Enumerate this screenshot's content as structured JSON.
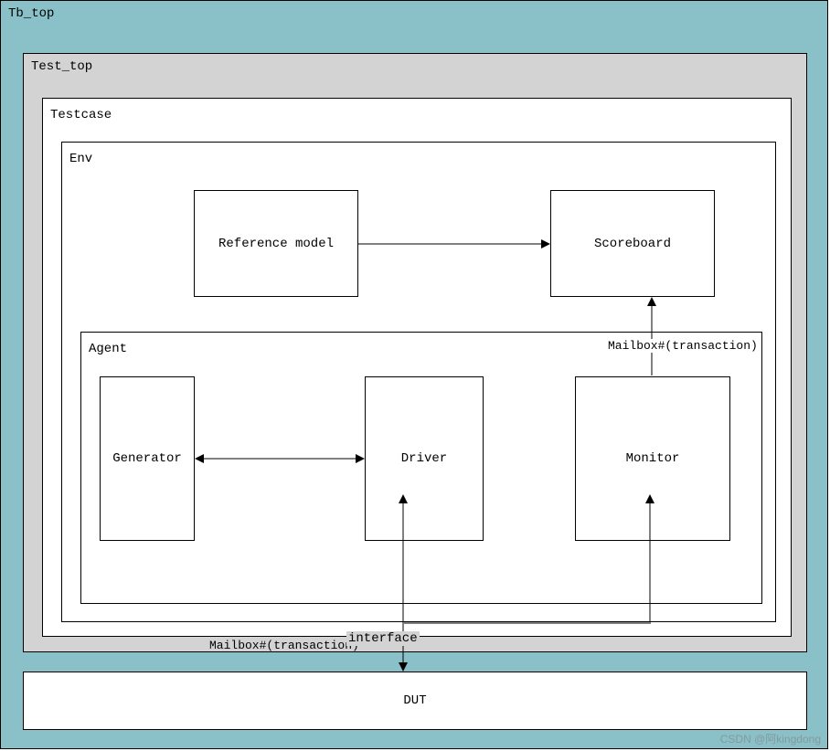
{
  "containers": {
    "tb_top": "Tb_top",
    "test_top": "Test_top",
    "testcase": "Testcase",
    "env": "Env",
    "agent": "Agent"
  },
  "blocks": {
    "reference_model": "Reference model",
    "scoreboard": "Scoreboard",
    "generator": "Generator",
    "driver": "Driver",
    "monitor": "Monitor",
    "dut": "DUT"
  },
  "connections": {
    "gen_driver": "Mailbox#(transaction)",
    "monitor_scoreboard": "Mailbox#(transaction)",
    "driver_dut": "interface"
  },
  "watermark": "CSDN @阿kingdong"
}
